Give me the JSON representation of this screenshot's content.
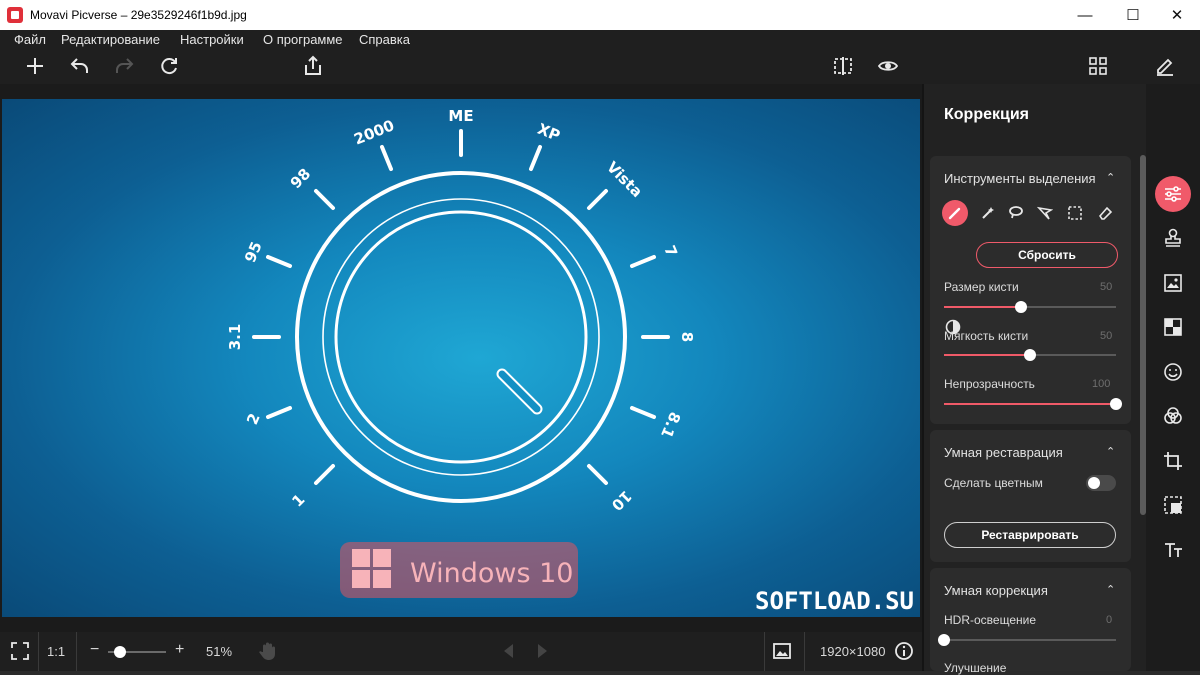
{
  "window": {
    "title": "Movavi Picverse – 29e3529246f1b9d.jpg",
    "minimize": "—",
    "maximize": "☐",
    "close": "✕"
  },
  "menu": [
    "Файл",
    "Редактирование",
    "Настройки",
    "О программе",
    "Справка"
  ],
  "image": {
    "dial_labels": [
      "1",
      "2",
      "3.1",
      "95",
      "98",
      "2000",
      "ME",
      "XP",
      "Vista",
      "7",
      "8",
      "8.1",
      "10"
    ],
    "logo_text": "Windows 10",
    "watermark": "SOFTLOAD.SU"
  },
  "bottom": {
    "ratio": "1:1",
    "minus": "−",
    "plus": "+",
    "zoom": "51%",
    "zoom_level": 0.2,
    "resolution": "1920×1080"
  },
  "panel": {
    "title": "Коррекция",
    "selection": {
      "title": "Инструменты выделения",
      "reset_label": "Сбросить",
      "brush_size_label": "Размер кисти",
      "brush_size_value": "50",
      "brush_size_level": 0.45,
      "softness_label": "Мягкость кисти",
      "softness_value": "50",
      "softness_level": 0.5,
      "opacity_label": "Непрозрачность",
      "opacity_value": "100",
      "opacity_level": 1.0
    },
    "restoration": {
      "title": "Умная реставрация",
      "colorize_label": "Сделать цветным",
      "restore_label": "Реставрировать"
    },
    "smart_correction": {
      "title": "Умная коррекция",
      "hdr_label": "HDR-освещение",
      "hdr_value": "0",
      "hdr_level": 0,
      "improve_label": "Улучшение"
    }
  },
  "colors": {
    "accent": "#f05a6a",
    "image_blue": "#1387bd"
  }
}
